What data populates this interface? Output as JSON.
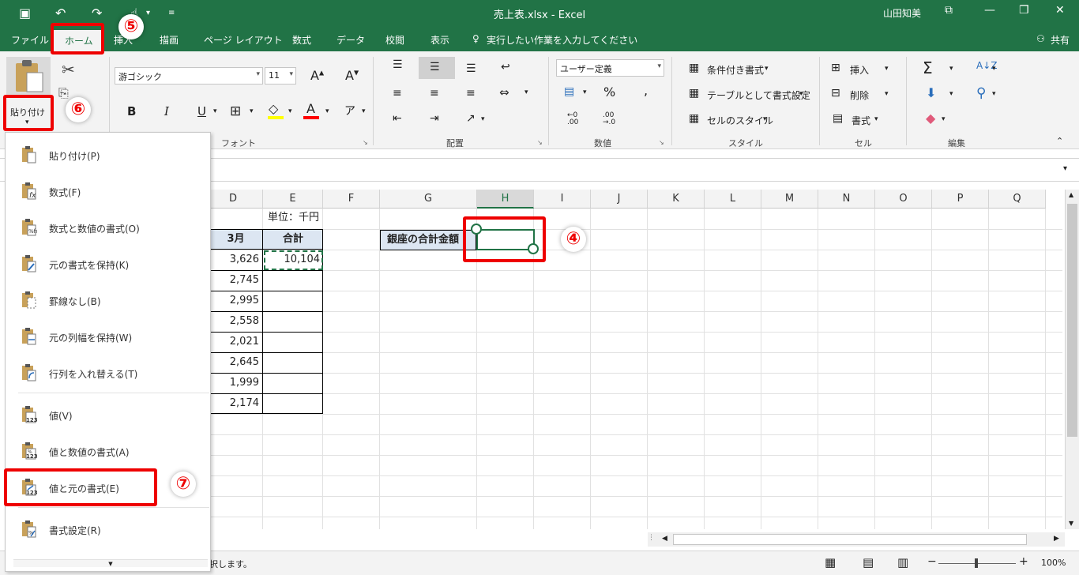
{
  "window": {
    "title": "売上表.xlsx  -  Excel",
    "user": "山田知美"
  },
  "tabs": [
    "ファイル",
    "ホーム",
    "挿入",
    "描画",
    "ページ レイアウト",
    "数式",
    "データ",
    "校閲",
    "表示"
  ],
  "tell_me": "実行したい作業を入力してください",
  "share": "共有",
  "ribbon": {
    "paste_label": "貼り付け",
    "font_name": "游ゴシック",
    "font_size": "11",
    "number_format": "ユーザー定義",
    "conditional_format": "条件付き書式",
    "format_as_table": "テーブルとして書式設定",
    "cell_styles": "セルのスタイル",
    "insert": "挿入",
    "delete": "削除",
    "format": "書式",
    "groups": {
      "font": "フォント",
      "alignment": "配置",
      "number": "数値",
      "styles": "スタイル",
      "cells": "セル",
      "editing": "編集"
    }
  },
  "grid": {
    "columns": [
      "D",
      "E",
      "F",
      "G",
      "H",
      "I",
      "J",
      "K",
      "L",
      "M",
      "N",
      "O",
      "P",
      "Q"
    ],
    "unit_label": "単位：千円",
    "header_march": "3月",
    "header_total": "合計",
    "march_values": [
      "3,626",
      "2,745",
      "2,995",
      "2,558",
      "2,021",
      "2,645",
      "1,999",
      "2,174"
    ],
    "total_value": "10,104",
    "ginza_label": "銀座の合計金額"
  },
  "paste_menu": {
    "items": [
      "貼り付け(P)",
      "数式(F)",
      "数式と数値の書式(O)",
      "元の書式を保持(K)",
      "罫線なし(B)",
      "元の列幅を保持(W)",
      "行列を入れ替える(T)",
      "値(V)",
      "値と数値の書式(A)",
      "値と元の書式(E)",
      "書式設定(R)"
    ]
  },
  "status": {
    "message": "択します。",
    "zoom": "100%"
  },
  "annotations": [
    "⑤",
    "⑥",
    "④",
    "⑦"
  ],
  "colors": {
    "excel_green": "#217346",
    "highlight_red": "#e00000",
    "fill_yellow": "#ffff00",
    "font_red": "#ff0000"
  }
}
